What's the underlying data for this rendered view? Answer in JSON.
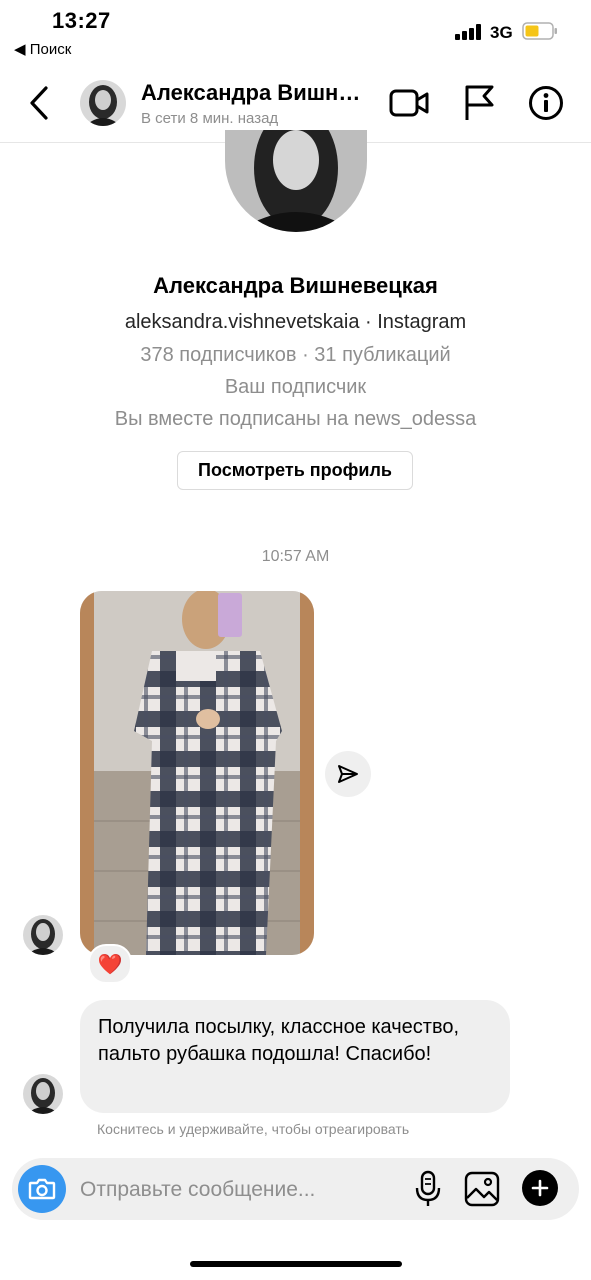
{
  "status_bar": {
    "time": "13:27",
    "back_label": "◀ Поиск",
    "network": "3G",
    "battery_color": "#f5c518"
  },
  "header": {
    "name": "Александра Вишн…",
    "status": "В сети 8 мин. назад",
    "icons": [
      "chevron-left-icon",
      "video-call-icon",
      "flag-icon",
      "info-icon"
    ]
  },
  "profile": {
    "name": "Александра Вишневецкая",
    "handle": "aleksandra.vishnevetskaia · Instagram",
    "stats": "378 подписчиков · 31 публикаций",
    "follower_note": "Ваш подписчик",
    "mutual": "Вы вместе подписаны на news_odessa",
    "view_profile_label": "Посмотреть профиль"
  },
  "thread": {
    "timestamp": "10:57 AM",
    "reaction": "❤️",
    "message": "Получила посылку, классное качество, пальто рубашка подошла! Спасибо!",
    "hint": "Коснитесь и удерживайте, чтобы отреагировать"
  },
  "composer": {
    "placeholder": "Отправьте сообщение...",
    "accent_color": "#3797f0",
    "icons": [
      "camera-icon",
      "microphone-icon",
      "gallery-icon",
      "plus-icon"
    ]
  }
}
